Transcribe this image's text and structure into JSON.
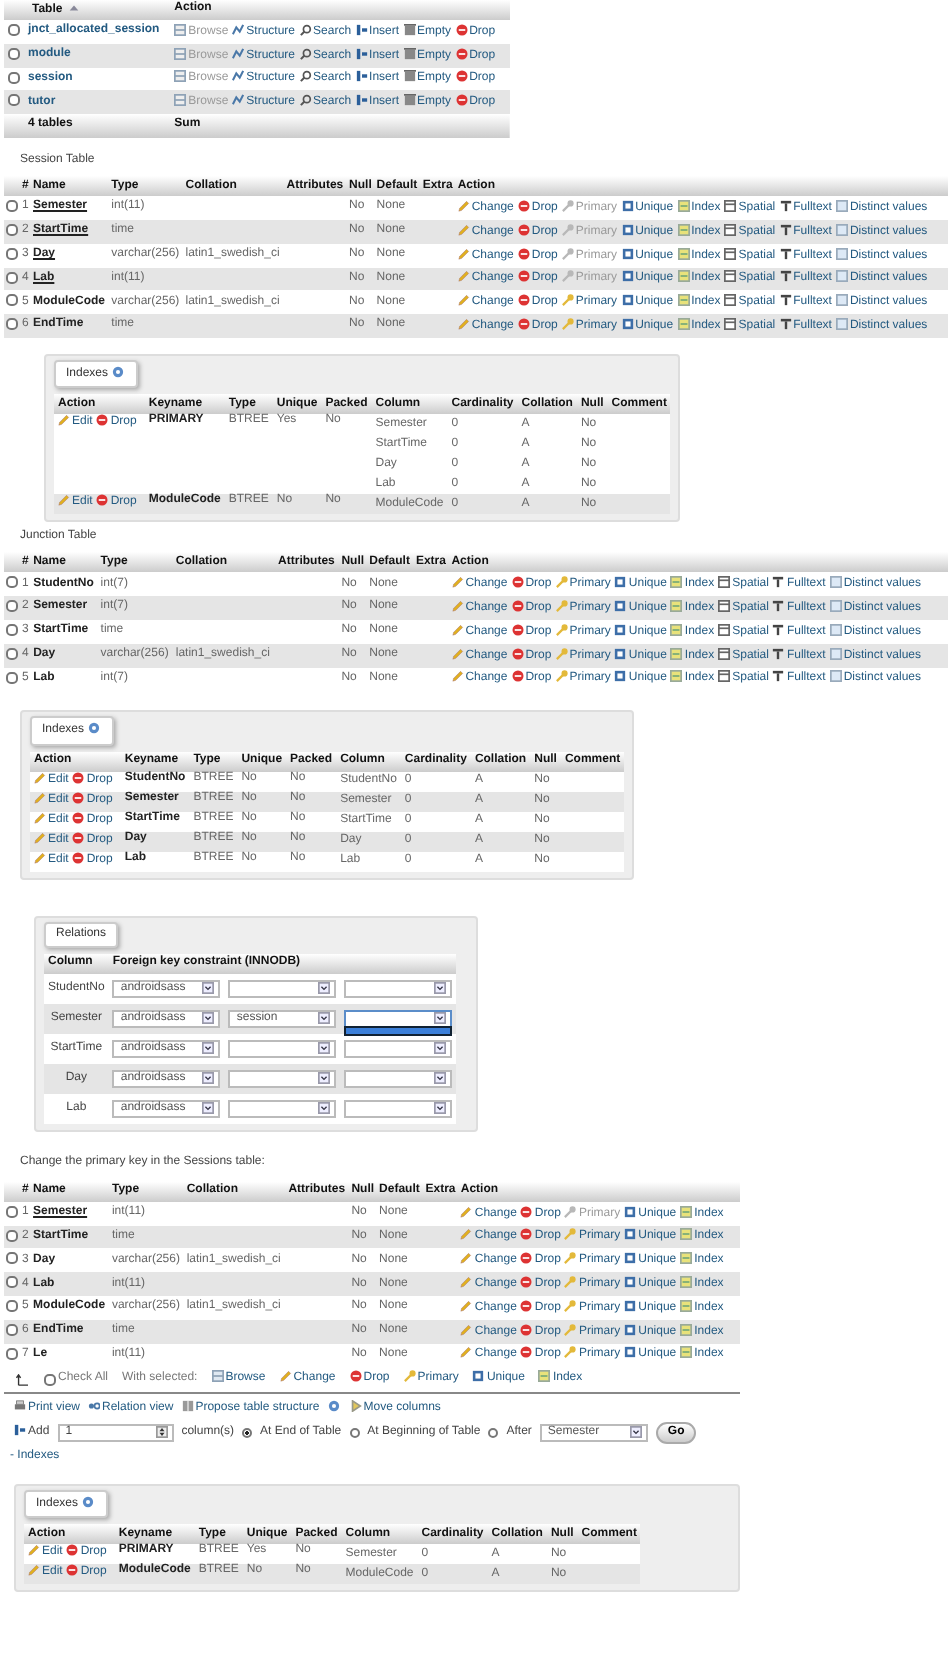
{
  "tables_list": {
    "columns": [
      {
        "label": "Table",
        "sorted": true
      },
      {
        "label": "Action",
        "sorted": false
      }
    ],
    "rows": [
      {
        "name": "jnct_allocated_session",
        "checked": false,
        "actions": [
          {
            "kind": "browse",
            "label": "Browse",
            "disabled": true
          },
          {
            "kind": "structure",
            "label": "Structure",
            "disabled": false
          },
          {
            "kind": "search",
            "label": "Search",
            "disabled": false
          },
          {
            "kind": "insert",
            "label": "Insert",
            "disabled": false
          },
          {
            "kind": "empty",
            "label": "Empty",
            "disabled": false
          },
          {
            "kind": "drop",
            "label": "Drop",
            "disabled": false
          }
        ]
      },
      {
        "name": "module",
        "checked": false,
        "actions": [
          {
            "kind": "browse",
            "label": "Browse",
            "disabled": true
          },
          {
            "kind": "structure",
            "label": "Structure",
            "disabled": false
          },
          {
            "kind": "search",
            "label": "Search",
            "disabled": false
          },
          {
            "kind": "insert",
            "label": "Insert",
            "disabled": false
          },
          {
            "kind": "empty",
            "label": "Empty",
            "disabled": false
          },
          {
            "kind": "drop",
            "label": "Drop",
            "disabled": false
          }
        ]
      },
      {
        "name": "session",
        "checked": false,
        "actions": [
          {
            "kind": "browse",
            "label": "Browse",
            "disabled": true
          },
          {
            "kind": "structure",
            "label": "Structure",
            "disabled": false
          },
          {
            "kind": "search",
            "label": "Search",
            "disabled": false
          },
          {
            "kind": "insert",
            "label": "Insert",
            "disabled": false
          },
          {
            "kind": "empty",
            "label": "Empty",
            "disabled": false
          },
          {
            "kind": "drop",
            "label": "Drop",
            "disabled": false
          }
        ]
      },
      {
        "name": "tutor",
        "checked": false,
        "actions": [
          {
            "kind": "browse",
            "label": "Browse",
            "disabled": true
          },
          {
            "kind": "structure",
            "label": "Structure",
            "disabled": false
          },
          {
            "kind": "search",
            "label": "Search",
            "disabled": false
          },
          {
            "kind": "insert",
            "label": "Insert",
            "disabled": false
          },
          {
            "kind": "empty",
            "label": "Empty",
            "disabled": false
          },
          {
            "kind": "drop",
            "label": "Drop",
            "disabled": false
          }
        ]
      }
    ],
    "footer": [
      "4 tables",
      "Sum"
    ]
  },
  "session_table": {
    "title": "Session Table",
    "columns": [
      "#",
      "Name",
      "Type",
      "Collation",
      "Attributes",
      "Null",
      "Default",
      "Extra",
      "Action"
    ],
    "rows": [
      {
        "number": "1",
        "name": "Semester",
        "primary": true,
        "checked": false,
        "type": "int(11)",
        "null": "No",
        "default": "None",
        "actions": [
          {
            "kind": "change",
            "label": "Change",
            "disabled": false
          },
          {
            "kind": "drop",
            "label": "Drop",
            "disabled": false
          },
          {
            "kind": "primary",
            "label": "Primary",
            "disabled": true
          },
          {
            "kind": "unique",
            "label": "Unique",
            "disabled": false
          },
          {
            "kind": "index",
            "label": "Index",
            "disabled": false
          },
          {
            "kind": "spatial",
            "label": "Spatial",
            "disabled": false
          },
          {
            "kind": "fulltext",
            "label": "Fulltext",
            "disabled": false
          },
          {
            "kind": "distinct",
            "label": "Distinct values",
            "disabled": false
          }
        ]
      },
      {
        "number": "2",
        "name": "StartTime",
        "primary": true,
        "checked": false,
        "type": "time",
        "null": "No",
        "default": "None",
        "actions": [
          {
            "kind": "change",
            "label": "Change",
            "disabled": false
          },
          {
            "kind": "drop",
            "label": "Drop",
            "disabled": false
          },
          {
            "kind": "primary",
            "label": "Primary",
            "disabled": true
          },
          {
            "kind": "unique",
            "label": "Unique",
            "disabled": false
          },
          {
            "kind": "index",
            "label": "Index",
            "disabled": false
          },
          {
            "kind": "spatial",
            "label": "Spatial",
            "disabled": false
          },
          {
            "kind": "fulltext",
            "label": "Fulltext",
            "disabled": false
          },
          {
            "kind": "distinct",
            "label": "Distinct values",
            "disabled": false
          }
        ]
      },
      {
        "number": "3",
        "name": "Day",
        "primary": true,
        "checked": false,
        "type": "varchar(256)",
        "collation": "latin1_swedish_ci",
        "null": "No",
        "default": "None",
        "actions": [
          {
            "kind": "change",
            "label": "Change",
            "disabled": false
          },
          {
            "kind": "drop",
            "label": "Drop",
            "disabled": false
          },
          {
            "kind": "primary",
            "label": "Primary",
            "disabled": true
          },
          {
            "kind": "unique",
            "label": "Unique",
            "disabled": false
          },
          {
            "kind": "index",
            "label": "Index",
            "disabled": false
          },
          {
            "kind": "spatial",
            "label": "Spatial",
            "disabled": false
          },
          {
            "kind": "fulltext",
            "label": "Fulltext",
            "disabled": false
          },
          {
            "kind": "distinct",
            "label": "Distinct values",
            "disabled": false
          }
        ]
      },
      {
        "number": "4",
        "name": "Lab",
        "primary": true,
        "checked": false,
        "type": "int(11)",
        "null": "No",
        "default": "None",
        "actions": [
          {
            "kind": "change",
            "label": "Change",
            "disabled": false
          },
          {
            "kind": "drop",
            "label": "Drop",
            "disabled": false
          },
          {
            "kind": "primary",
            "label": "Primary",
            "disabled": true
          },
          {
            "kind": "unique",
            "label": "Unique",
            "disabled": false
          },
          {
            "kind": "index",
            "label": "Index",
            "disabled": false
          },
          {
            "kind": "spatial",
            "label": "Spatial",
            "disabled": false
          },
          {
            "kind": "fulltext",
            "label": "Fulltext",
            "disabled": false
          },
          {
            "kind": "distinct",
            "label": "Distinct values",
            "disabled": false
          }
        ]
      },
      {
        "number": "5",
        "name": "ModuleCode",
        "primary": false,
        "checked": false,
        "type": "varchar(256)",
        "collation": "latin1_swedish_ci",
        "null": "No",
        "default": "None",
        "actions": [
          {
            "kind": "change",
            "label": "Change",
            "disabled": false
          },
          {
            "kind": "drop",
            "label": "Drop",
            "disabled": false
          },
          {
            "kind": "primary",
            "label": "Primary",
            "disabled": false
          },
          {
            "kind": "unique",
            "label": "Unique",
            "disabled": false
          },
          {
            "kind": "index",
            "label": "Index",
            "disabled": false
          },
          {
            "kind": "spatial",
            "label": "Spatial",
            "disabled": false
          },
          {
            "kind": "fulltext",
            "label": "Fulltext",
            "disabled": false
          },
          {
            "kind": "distinct",
            "label": "Distinct values",
            "disabled": false
          }
        ]
      },
      {
        "number": "6",
        "name": "EndTime",
        "primary": false,
        "checked": false,
        "type": "time",
        "null": "No",
        "default": "None",
        "actions": [
          {
            "kind": "change",
            "label": "Change",
            "disabled": false
          },
          {
            "kind": "drop",
            "label": "Drop",
            "disabled": false
          },
          {
            "kind": "primary",
            "label": "Primary",
            "disabled": false
          },
          {
            "kind": "unique",
            "label": "Unique",
            "disabled": false
          },
          {
            "kind": "index",
            "label": "Index",
            "disabled": false
          },
          {
            "kind": "spatial",
            "label": "Spatial",
            "disabled": false
          },
          {
            "kind": "fulltext",
            "label": "Fulltext",
            "disabled": false
          },
          {
            "kind": "distinct",
            "label": "Distinct values",
            "disabled": false
          }
        ]
      }
    ]
  },
  "session_indexes": {
    "legend": "Indexes",
    "columns": [
      "Action",
      "Keyname",
      "Type",
      "Unique",
      "Packed",
      "Column",
      "Cardinality",
      "Collation",
      "Null",
      "Comment"
    ],
    "indexes": [
      {
        "actions": [
          {
            "kind": "edit",
            "label": "Edit"
          },
          {
            "kind": "drop",
            "label": "Drop"
          }
        ],
        "keyname": "PRIMARY",
        "type": "BTREE",
        "unique": "Yes",
        "packed": "No",
        "columns": [
          {
            "column": "Semester",
            "cardinality": "0",
            "collation": "A",
            "null": "No"
          },
          {
            "column": "StartTime",
            "cardinality": "0",
            "collation": "A",
            "null": "No"
          },
          {
            "column": "Day",
            "cardinality": "0",
            "collation": "A",
            "null": "No"
          },
          {
            "column": "Lab",
            "cardinality": "0",
            "collation": "A",
            "null": "No"
          }
        ]
      },
      {
        "actions": [
          {
            "kind": "edit",
            "label": "Edit"
          },
          {
            "kind": "drop",
            "label": "Drop"
          }
        ],
        "keyname": "ModuleCode",
        "type": "BTREE",
        "unique": "No",
        "packed": "No",
        "columns": [
          {
            "column": "ModuleCode",
            "cardinality": "0",
            "collation": "A",
            "null": "No"
          }
        ]
      }
    ]
  },
  "junction_table": {
    "title": "Junction Table",
    "columns": [
      "#",
      "Name",
      "Type",
      "Collation",
      "Attributes",
      "Null",
      "Default",
      "Extra",
      "Action"
    ],
    "rows": [
      {
        "number": "1",
        "name": "StudentNo",
        "primary": false,
        "checked": false,
        "type": "int(7)",
        "null": "No",
        "default": "None",
        "actions": [
          {
            "kind": "change",
            "label": "Change",
            "disabled": false
          },
          {
            "kind": "drop",
            "label": "Drop",
            "disabled": false
          },
          {
            "kind": "primary",
            "label": "Primary",
            "disabled": false
          },
          {
            "kind": "unique",
            "label": "Unique",
            "disabled": false
          },
          {
            "kind": "index",
            "label": "Index",
            "disabled": false
          },
          {
            "kind": "spatial",
            "label": "Spatial",
            "disabled": false
          },
          {
            "kind": "fulltext",
            "label": "Fulltext",
            "disabled": false
          },
          {
            "kind": "distinct",
            "label": "Distinct values",
            "disabled": false
          }
        ]
      },
      {
        "number": "2",
        "name": "Semester",
        "primary": false,
        "checked": false,
        "type": "int(7)",
        "null": "No",
        "default": "None",
        "actions": [
          {
            "kind": "change",
            "label": "Change",
            "disabled": false
          },
          {
            "kind": "drop",
            "label": "Drop",
            "disabled": false
          },
          {
            "kind": "primary",
            "label": "Primary",
            "disabled": false
          },
          {
            "kind": "unique",
            "label": "Unique",
            "disabled": false
          },
          {
            "kind": "index",
            "label": "Index",
            "disabled": false
          },
          {
            "kind": "spatial",
            "label": "Spatial",
            "disabled": false
          },
          {
            "kind": "fulltext",
            "label": "Fulltext",
            "disabled": false
          },
          {
            "kind": "distinct",
            "label": "Distinct values",
            "disabled": false
          }
        ]
      },
      {
        "number": "3",
        "name": "StartTime",
        "primary": false,
        "checked": false,
        "type": "time",
        "null": "No",
        "default": "None",
        "actions": [
          {
            "kind": "change",
            "label": "Change",
            "disabled": false
          },
          {
            "kind": "drop",
            "label": "Drop",
            "disabled": false
          },
          {
            "kind": "primary",
            "label": "Primary",
            "disabled": false
          },
          {
            "kind": "unique",
            "label": "Unique",
            "disabled": false
          },
          {
            "kind": "index",
            "label": "Index",
            "disabled": false
          },
          {
            "kind": "spatial",
            "label": "Spatial",
            "disabled": false
          },
          {
            "kind": "fulltext",
            "label": "Fulltext",
            "disabled": false
          },
          {
            "kind": "distinct",
            "label": "Distinct values",
            "disabled": false
          }
        ]
      },
      {
        "number": "4",
        "name": "Day",
        "primary": false,
        "checked": false,
        "type": "varchar(256)",
        "collation": "latin1_swedish_ci",
        "null": "No",
        "default": "None",
        "actions": [
          {
            "kind": "change",
            "label": "Change",
            "disabled": false
          },
          {
            "kind": "drop",
            "label": "Drop",
            "disabled": false
          },
          {
            "kind": "primary",
            "label": "Primary",
            "disabled": false
          },
          {
            "kind": "unique",
            "label": "Unique",
            "disabled": false
          },
          {
            "kind": "index",
            "label": "Index",
            "disabled": false
          },
          {
            "kind": "spatial",
            "label": "Spatial",
            "disabled": false
          },
          {
            "kind": "fulltext",
            "label": "Fulltext",
            "disabled": false
          },
          {
            "kind": "distinct",
            "label": "Distinct values",
            "disabled": false
          }
        ]
      },
      {
        "number": "5",
        "name": "Lab",
        "primary": false,
        "checked": false,
        "type": "int(7)",
        "null": "No",
        "default": "None",
        "actions": [
          {
            "kind": "change",
            "label": "Change",
            "disabled": false
          },
          {
            "kind": "drop",
            "label": "Drop",
            "disabled": false
          },
          {
            "kind": "primary",
            "label": "Primary",
            "disabled": false
          },
          {
            "kind": "unique",
            "label": "Unique",
            "disabled": false
          },
          {
            "kind": "index",
            "label": "Index",
            "disabled": false
          },
          {
            "kind": "spatial",
            "label": "Spatial",
            "disabled": false
          },
          {
            "kind": "fulltext",
            "label": "Fulltext",
            "disabled": false
          },
          {
            "kind": "distinct",
            "label": "Distinct values",
            "disabled": false
          }
        ]
      }
    ]
  },
  "junction_indexes": {
    "legend": "Indexes",
    "columns": [
      "Action",
      "Keyname",
      "Type",
      "Unique",
      "Packed",
      "Column",
      "Cardinality",
      "Collation",
      "Null",
      "Comment"
    ],
    "indexes": [
      {
        "actions": [
          {
            "kind": "edit",
            "label": "Edit"
          },
          {
            "kind": "drop",
            "label": "Drop"
          }
        ],
        "keyname": "StudentNo",
        "type": "BTREE",
        "unique": "No",
        "packed": "No",
        "columns": [
          {
            "column": "StudentNo",
            "cardinality": "0",
            "collation": "A",
            "null": "No"
          }
        ]
      },
      {
        "actions": [
          {
            "kind": "edit",
            "label": "Edit"
          },
          {
            "kind": "drop",
            "label": "Drop"
          }
        ],
        "keyname": "Semester",
        "type": "BTREE",
        "unique": "No",
        "packed": "No",
        "columns": [
          {
            "column": "Semester",
            "cardinality": "0",
            "collation": "A",
            "null": "No"
          }
        ]
      },
      {
        "actions": [
          {
            "kind": "edit",
            "label": "Edit"
          },
          {
            "kind": "drop",
            "label": "Drop"
          }
        ],
        "keyname": "StartTime",
        "type": "BTREE",
        "unique": "No",
        "packed": "No",
        "columns": [
          {
            "column": "StartTime",
            "cardinality": "0",
            "collation": "A",
            "null": "No"
          }
        ]
      },
      {
        "actions": [
          {
            "kind": "edit",
            "label": "Edit"
          },
          {
            "kind": "drop",
            "label": "Drop"
          }
        ],
        "keyname": "Day",
        "type": "BTREE",
        "unique": "No",
        "packed": "No",
        "columns": [
          {
            "column": "Day",
            "cardinality": "0",
            "collation": "A",
            "null": "No"
          }
        ]
      },
      {
        "actions": [
          {
            "kind": "edit",
            "label": "Edit"
          },
          {
            "kind": "drop",
            "label": "Drop"
          }
        ],
        "keyname": "Lab",
        "type": "BTREE",
        "unique": "No",
        "packed": "No",
        "columns": [
          {
            "column": "Lab",
            "cardinality": "0",
            "collation": "A",
            "null": "No"
          }
        ]
      }
    ]
  },
  "relations": {
    "legend": "Relations",
    "columns": [
      "Column",
      "Foreign key constraint (INNODB)"
    ],
    "rows": [
      {
        "column": "StudentNo",
        "database": "androidsass",
        "column_select_open": false
      },
      {
        "column": "Semester",
        "database": "androidsass",
        "table": "session",
        "column_select_open": true
      },
      {
        "column": "StartTime",
        "database": "androidsass",
        "column_select_open": false
      },
      {
        "column": "Day",
        "database": "androidsass",
        "column_select_open": false
      },
      {
        "column": "Lab",
        "database": "androidsass",
        "column_select_open": false
      }
    ]
  },
  "primary_key_table": {
    "title": "Change the primary key in the Sessions table:",
    "columns": [
      "#",
      "Name",
      "Type",
      "Collation",
      "Attributes",
      "Null",
      "Default",
      "Extra",
      "Action"
    ],
    "rows": [
      {
        "number": "1",
        "name": "Semester",
        "primary": true,
        "checked": false,
        "type": "int(11)",
        "null": "No",
        "default": "None",
        "actions": [
          {
            "kind": "change",
            "label": "Change",
            "disabled": false
          },
          {
            "kind": "drop",
            "label": "Drop",
            "disabled": false
          },
          {
            "kind": "primary",
            "label": "Primary",
            "disabled": true
          },
          {
            "kind": "unique",
            "label": "Unique",
            "disabled": false
          },
          {
            "kind": "index",
            "label": "Index",
            "disabled": false
          }
        ]
      },
      {
        "number": "2",
        "name": "StartTime",
        "primary": false,
        "checked": false,
        "type": "time",
        "null": "No",
        "default": "None",
        "actions": [
          {
            "kind": "change",
            "label": "Change",
            "disabled": false
          },
          {
            "kind": "drop",
            "label": "Drop",
            "disabled": false
          },
          {
            "kind": "primary",
            "label": "Primary",
            "disabled": false
          },
          {
            "kind": "unique",
            "label": "Unique",
            "disabled": false
          },
          {
            "kind": "index",
            "label": "Index",
            "disabled": false
          }
        ]
      },
      {
        "number": "3",
        "name": "Day",
        "primary": false,
        "checked": false,
        "type": "varchar(256)",
        "collation": "latin1_swedish_ci",
        "null": "No",
        "default": "None",
        "actions": [
          {
            "kind": "change",
            "label": "Change",
            "disabled": false
          },
          {
            "kind": "drop",
            "label": "Drop",
            "disabled": false
          },
          {
            "kind": "primary",
            "label": "Primary",
            "disabled": false
          },
          {
            "kind": "unique",
            "label": "Unique",
            "disabled": false
          },
          {
            "kind": "index",
            "label": "Index",
            "disabled": false
          }
        ]
      },
      {
        "number": "4",
        "name": "Lab",
        "primary": false,
        "checked": false,
        "type": "int(11)",
        "null": "No",
        "default": "None",
        "actions": [
          {
            "kind": "change",
            "label": "Change",
            "disabled": false
          },
          {
            "kind": "drop",
            "label": "Drop",
            "disabled": false
          },
          {
            "kind": "primary",
            "label": "Primary",
            "disabled": false
          },
          {
            "kind": "unique",
            "label": "Unique",
            "disabled": false
          },
          {
            "kind": "index",
            "label": "Index",
            "disabled": false
          }
        ]
      },
      {
        "number": "5",
        "name": "ModuleCode",
        "primary": false,
        "checked": false,
        "type": "varchar(256)",
        "collation": "latin1_swedish_ci",
        "null": "No",
        "default": "None",
        "actions": [
          {
            "kind": "change",
            "label": "Change",
            "disabled": false
          },
          {
            "kind": "drop",
            "label": "Drop",
            "disabled": false
          },
          {
            "kind": "primary",
            "label": "Primary",
            "disabled": false
          },
          {
            "kind": "unique",
            "label": "Unique",
            "disabled": false
          },
          {
            "kind": "index",
            "label": "Index",
            "disabled": false
          }
        ]
      },
      {
        "number": "6",
        "name": "EndTime",
        "primary": false,
        "checked": false,
        "type": "time",
        "null": "No",
        "default": "None",
        "actions": [
          {
            "kind": "change",
            "label": "Change",
            "disabled": false
          },
          {
            "kind": "drop",
            "label": "Drop",
            "disabled": false
          },
          {
            "kind": "primary",
            "label": "Primary",
            "disabled": false
          },
          {
            "kind": "unique",
            "label": "Unique",
            "disabled": false
          },
          {
            "kind": "index",
            "label": "Index",
            "disabled": false
          }
        ]
      },
      {
        "number": "7",
        "name": "Le",
        "primary": false,
        "checked": false,
        "type": "int(11)",
        "null": "No",
        "default": "None",
        "actions": [
          {
            "kind": "change",
            "label": "Change",
            "disabled": false
          },
          {
            "kind": "drop",
            "label": "Drop",
            "disabled": false
          },
          {
            "kind": "primary",
            "label": "Primary",
            "disabled": false
          },
          {
            "kind": "unique",
            "label": "Unique",
            "disabled": false
          },
          {
            "kind": "index",
            "label": "Index",
            "disabled": false
          }
        ]
      }
    ]
  },
  "bulk_bar": {
    "check_all": {
      "label": "Check All",
      "checked": false
    },
    "with_selected": "With selected:",
    "buttons": [
      {
        "kind": "browse",
        "label": "Browse"
      },
      {
        "kind": "change",
        "label": "Change"
      },
      {
        "kind": "drop",
        "label": "Drop"
      },
      {
        "kind": "primary",
        "label": "Primary"
      },
      {
        "kind": "unique",
        "label": "Unique"
      },
      {
        "kind": "index",
        "label": "Index"
      }
    ]
  },
  "table_links": [
    {
      "kind": "print",
      "label": "Print view"
    },
    {
      "kind": "relation",
      "label": "Relation view"
    },
    {
      "kind": "propose",
      "label": "Propose table structure",
      "help": true
    },
    {
      "kind": "move",
      "label": "Move columns"
    }
  ],
  "add_columns": {
    "label": "Add",
    "value": "1",
    "unit": "column(s)",
    "positions": [
      {
        "label": "At End of Table",
        "selected": true
      },
      {
        "label": "At Beginning of Table",
        "selected": false
      },
      {
        "label": "After",
        "selected": false
      }
    ],
    "after_column": "Semester",
    "go": "Go"
  },
  "indexes_toggle": "- Indexes",
  "final_indexes": {
    "legend": "Indexes",
    "columns": [
      "Action",
      "Keyname",
      "Type",
      "Unique",
      "Packed",
      "Column",
      "Cardinality",
      "Collation",
      "Null",
      "Comment"
    ],
    "indexes": [
      {
        "actions": [
          {
            "kind": "edit",
            "label": "Edit"
          },
          {
            "kind": "drop",
            "label": "Drop"
          }
        ],
        "keyname": "PRIMARY",
        "type": "BTREE",
        "unique": "Yes",
        "packed": "No",
        "columns": [
          {
            "column": "Semester",
            "cardinality": "0",
            "collation": "A",
            "null": "No"
          }
        ]
      },
      {
        "actions": [
          {
            "kind": "edit",
            "label": "Edit"
          },
          {
            "kind": "drop",
            "label": "Drop"
          }
        ],
        "keyname": "ModuleCode",
        "type": "BTREE",
        "unique": "No",
        "packed": "No",
        "columns": [
          {
            "column": "ModuleCode",
            "cardinality": "0",
            "collation": "A",
            "null": "No"
          }
        ]
      }
    ]
  }
}
